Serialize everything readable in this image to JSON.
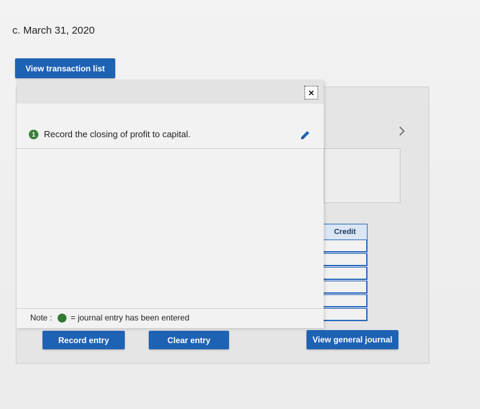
{
  "heading": "c. March 31, 2020",
  "buttons": {
    "view_transaction_list": "View transaction list",
    "record_entry": "Record entry",
    "clear_entry": "Clear entry",
    "view_general_journal": "View general journal"
  },
  "modal": {
    "close_glyph": "×",
    "step_number": "1",
    "step_text": "Record the closing of profit to capital.",
    "note_label": "Note :",
    "note_text": "= journal entry has been entered"
  },
  "journal": {
    "credit_header": "Credit"
  },
  "colors": {
    "primary_button": "#1e62b4",
    "entered_green": "#2f7b2f"
  }
}
